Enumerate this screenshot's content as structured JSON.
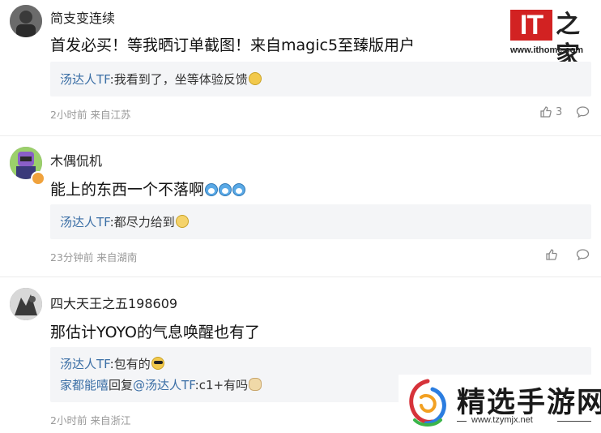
{
  "site_logo": {
    "mark": "IT",
    "label": "之家",
    "url": "www.ithome.com"
  },
  "comments": [
    {
      "username": "简支变连续",
      "content": "首发必买！等我晒订单截图！来自magic5至臻版用户",
      "replies": [
        {
          "author": "汤达人TF",
          "text": ":我看到了，坐等体验反馈",
          "emoji": "cry-laugh"
        }
      ],
      "time": "2小时前",
      "location": "来自江苏",
      "likes": "3"
    },
    {
      "username": "木偶侃机",
      "content": "能上的东西一个不落啊",
      "content_emojis": [
        "doraemon",
        "doraemon",
        "doraemon"
      ],
      "replies": [
        {
          "author": "汤达人TF",
          "text": ":都尽力给到",
          "emoji": "grin"
        }
      ],
      "time": "23分钟前",
      "location": "来自湖南",
      "likes": ""
    },
    {
      "username": "四大天王之五198609",
      "content": "那估计YOYO的气息唤醒也有了",
      "replies": [
        {
          "author": "汤达人TF",
          "text": ":包有的",
          "emoji": "sunglasses"
        },
        {
          "author": "家都能嘻",
          "text": "回复",
          "mention": "@汤达人TF",
          "tail": ":c1+有吗",
          "emoji": "cat"
        }
      ],
      "time": "2小时前",
      "location": "来自浙江"
    }
  ],
  "icons": {
    "like": "thumbs-up-icon",
    "reply": "comment-bubble-icon"
  },
  "watermark": {
    "title": "精选手游网",
    "url": "www.tzymjx.net"
  },
  "colors": {
    "reply_name": "#3a6ea5",
    "meta": "#999999",
    "logo_red": "#d22222",
    "reply_bg": "#f4f5f7"
  }
}
